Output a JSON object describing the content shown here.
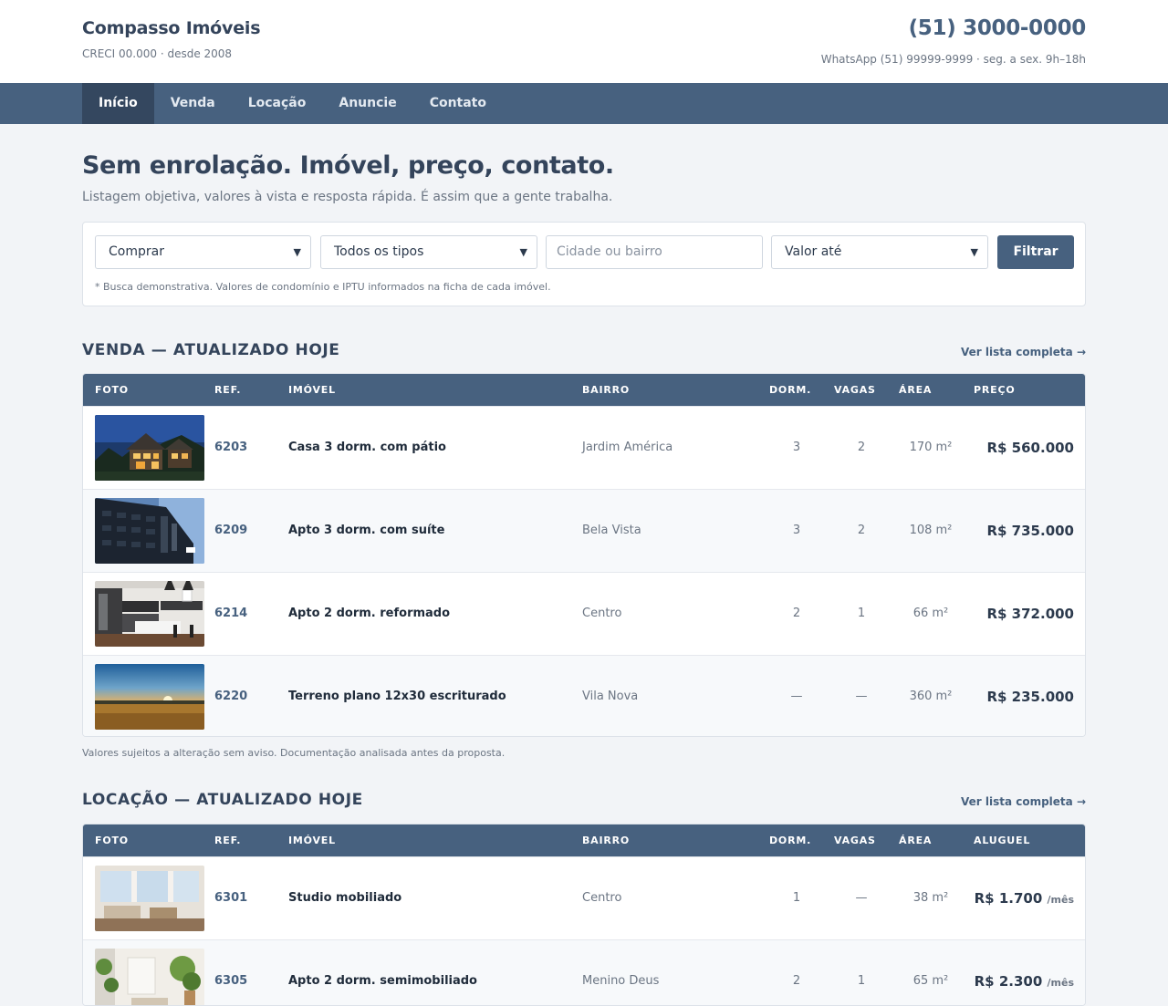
{
  "header": {
    "brand": "Compasso Imóveis",
    "brand_sub": "CRECI 00.000 · desde 2008",
    "phone": "(51) 3000-0000",
    "phone_sub": "WhatsApp (51) 99999-9999 · seg. a sex. 9h–18h"
  },
  "nav": [
    {
      "label": "Início",
      "active": true
    },
    {
      "label": "Venda"
    },
    {
      "label": "Locação"
    },
    {
      "label": "Anuncie"
    },
    {
      "label": "Contato"
    }
  ],
  "hero": {
    "title": "Sem enrolação. Imóvel, preço, contato.",
    "subtitle": "Listagem objetiva, valores à vista e resposta rápida. É assim que a gente trabalha."
  },
  "search": {
    "mode": "Comprar",
    "type": "Todos os tipos",
    "city_placeholder": "Cidade ou bairro",
    "max_value": "Valor até",
    "button": "Filtrar",
    "note": "* Busca demonstrativa. Valores de condomínio e IPTU informados na ficha de cada imóvel."
  },
  "sale": {
    "title": "VENDA — ATUALIZADO HOJE",
    "link": "Ver lista completa →",
    "columns": [
      "FOTO",
      "REF.",
      "IMÓVEL",
      "BAIRRO",
      "DORM.",
      "VAGAS",
      "ÁREA",
      "PREÇO"
    ],
    "rows": [
      {
        "ref": "6203",
        "name": "Casa 3 dorm. com pátio",
        "bairro": "Jardim América",
        "dorm": "3",
        "vagas": "2",
        "area": "170 m²",
        "price": "R$ 560.000",
        "photo": "house-photo"
      },
      {
        "ref": "6209",
        "name": "Apto 3 dorm. com suíte",
        "bairro": "Bela Vista",
        "dorm": "3",
        "vagas": "2",
        "area": "108 m²",
        "price": "R$ 735.000",
        "photo": "building-photo"
      },
      {
        "ref": "6214",
        "name": "Apto 2 dorm. reformado",
        "bairro": "Centro",
        "dorm": "2",
        "vagas": "1",
        "area": "66 m²",
        "price": "R$ 372.000",
        "photo": "kitchen-photo"
      },
      {
        "ref": "6220",
        "name": "Terreno plano 12x30 escriturado",
        "bairro": "Vila Nova",
        "dorm": "—",
        "vagas": "—",
        "area": "360 m²",
        "price": "R$ 235.000",
        "photo": "field-sunset-photo"
      }
    ],
    "note": "Valores sujeitos a alteração sem aviso. Documentação analisada antes da proposta."
  },
  "rent": {
    "title": "LOCAÇÃO — ATUALIZADO HOJE",
    "link": "Ver lista completa →",
    "columns": [
      "FOTO",
      "REF.",
      "IMÓVEL",
      "BAIRRO",
      "DORM.",
      "VAGAS",
      "ÁREA",
      "ALUGUEL"
    ],
    "rows": [
      {
        "ref": "6301",
        "name": "Studio mobiliado",
        "bairro": "Centro",
        "dorm": "1",
        "vagas": "—",
        "area": "38 m²",
        "price": "R$ 1.700",
        "per": "/mês",
        "photo": "living-room-photo"
      },
      {
        "ref": "6305",
        "name": "Apto 2 dorm. semimobiliado",
        "bairro": "Menino Deus",
        "dorm": "2",
        "vagas": "1",
        "area": "65 m²",
        "price": "R$ 2.300",
        "per": "/mês",
        "photo": "plants-room-photo"
      }
    ]
  },
  "colors": {
    "primary": "#47617f",
    "nav_active": "#34475f",
    "background": "#f2f4f7"
  }
}
